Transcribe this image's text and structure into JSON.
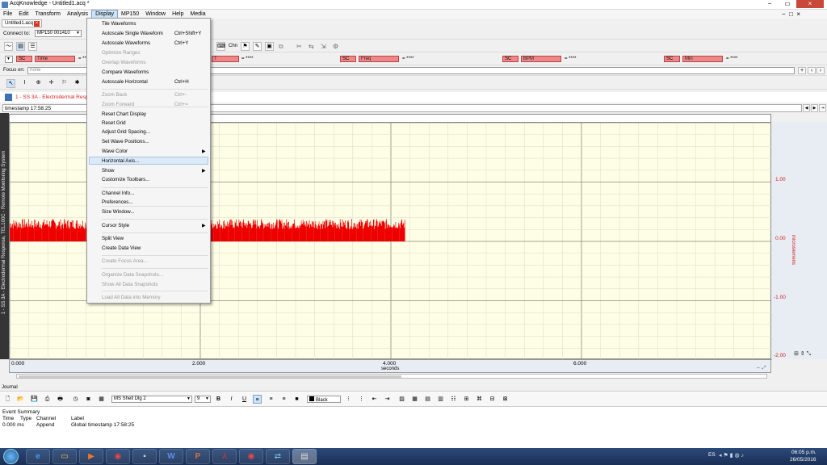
{
  "window": {
    "title": "AcqKnowledge - Untitled1.acq *",
    "min": "−",
    "max": "□",
    "close": "×",
    "title_min": "−",
    "title_restore": "▭",
    "title_close": "×"
  },
  "menubar": [
    "File",
    "Edit",
    "Transform",
    "Analysis",
    "Display",
    "MP150",
    "Window",
    "Help",
    "Media"
  ],
  "doc_tab": {
    "label": "Untitled1.acq",
    "close": "×"
  },
  "connect": {
    "label": "Connect to:",
    "value": "MP150 001410"
  },
  "toolbar": {
    "chn_label": "Chn"
  },
  "measurements": [
    {
      "channel": "SC",
      "func": "Time",
      "value": "= ****"
    },
    {
      "channel": "",
      "func": "T",
      "value": "= ****"
    },
    {
      "channel": "SC",
      "func": "Freq",
      "value": "= ****"
    },
    {
      "channel": "SC",
      "func": "BPM",
      "value": "= ****"
    },
    {
      "channel": "SC",
      "func": "Min",
      "value": "= ****"
    }
  ],
  "focus": {
    "label": "Focus on:",
    "value": "none"
  },
  "channel_label": "1 - SS 3A - Electrodermal Resp",
  "event_label": "timestamp 17:58:25",
  "left_axis_label": "1 - SS 3A - Electrodermal Response, TEL100C - Remote Monitoring System",
  "right_axis_label": "microsiemens",
  "chart_data": {
    "type": "line",
    "xlabel": "seconds",
    "x_ticks": [
      "0.000",
      "2.000",
      "4.000",
      "6.000"
    ],
    "y_ticks": [
      "1.00",
      "0.00",
      "-1.00",
      "-2.00"
    ],
    "xlim": [
      0,
      8
    ],
    "ylim": [
      -2,
      2
    ],
    "color": "#ee0000",
    "series": [
      {
        "segments": [
          [
            0.0,
            1.3,
            0.0,
            0.38
          ],
          [
            2.1,
            4.15,
            0.0,
            0.38
          ]
        ]
      }
    ]
  },
  "display_menu": {
    "items": [
      {
        "label": "Tile Waveforms",
        "shortcut": "",
        "disabled": false,
        "sub": false
      },
      {
        "label": "Autoscale Single Waveform",
        "shortcut": "Ctrl+Shift+Y",
        "disabled": false,
        "sub": false
      },
      {
        "label": "Autoscale Waveforms",
        "shortcut": "Ctrl+Y",
        "disabled": false,
        "sub": false
      },
      {
        "label": "Optimize Ranges",
        "shortcut": "",
        "disabled": true,
        "sub": false
      },
      {
        "label": "Overlap Waveforms",
        "shortcut": "",
        "disabled": true,
        "sub": false
      },
      {
        "label": "Compare Waveforms",
        "shortcut": "",
        "disabled": false,
        "sub": false
      },
      {
        "label": "Autoscale Horizontal",
        "shortcut": "Ctrl+H",
        "disabled": false,
        "sub": false
      },
      {
        "label": "Zoom Back",
        "shortcut": "Ctrl+-",
        "disabled": true,
        "sub": false
      },
      {
        "label": "Zoom Forward",
        "shortcut": "Ctrl+=",
        "disabled": true,
        "sub": false
      },
      {
        "label": "Reset Chart Display",
        "shortcut": "",
        "disabled": false,
        "sub": false
      },
      {
        "label": "Reset Grid",
        "shortcut": "",
        "disabled": false,
        "sub": false
      },
      {
        "label": "Adjust Grid Spacing...",
        "shortcut": "",
        "disabled": false,
        "sub": false
      },
      {
        "label": "Set Wave Positions...",
        "shortcut": "",
        "disabled": false,
        "sub": false
      },
      {
        "label": "Wave Color",
        "shortcut": "",
        "disabled": false,
        "sub": true
      },
      {
        "label": "Horizontal Axis...",
        "shortcut": "",
        "disabled": false,
        "sub": false,
        "highlight": true
      },
      {
        "label": "Show",
        "shortcut": "",
        "disabled": false,
        "sub": true
      },
      {
        "label": "Customize Toolbars...",
        "shortcut": "",
        "disabled": false,
        "sub": false
      },
      {
        "label": "Channel Info...",
        "shortcut": "",
        "disabled": false,
        "sub": false
      },
      {
        "label": "Preferences...",
        "shortcut": "",
        "disabled": false,
        "sub": false
      },
      {
        "label": "Size Window...",
        "shortcut": "",
        "disabled": false,
        "sub": false
      },
      {
        "label": "Cursor Style",
        "shortcut": "",
        "disabled": false,
        "sub": true
      },
      {
        "label": "Split View",
        "shortcut": "",
        "disabled": false,
        "sub": false
      },
      {
        "label": "Create Data View",
        "shortcut": "",
        "disabled": false,
        "sub": false
      },
      {
        "label": "Create Focus Area...",
        "shortcut": "",
        "disabled": true,
        "sub": false
      },
      {
        "label": "Organize Data Snapshots...",
        "shortcut": "",
        "disabled": true,
        "sub": false
      },
      {
        "label": "Show All Data Snapshots",
        "shortcut": "",
        "disabled": true,
        "sub": false
      },
      {
        "label": "Load All Data into Memory",
        "shortcut": "",
        "disabled": true,
        "sub": false
      }
    ]
  },
  "journal": {
    "title": "Journal",
    "font": "MS Shell Dlg 2",
    "size": "9",
    "color": "Black",
    "summary_title": "Event Summary",
    "headers": [
      "Time",
      "Type",
      "Channel",
      "Label"
    ],
    "row": [
      "0.000 ms",
      "Append",
      "Global",
      "timestamp 17:58:25"
    ]
  },
  "tray": {
    "lang": "ES",
    "time": "06:05 p.m.",
    "date": "26/05/2016"
  }
}
